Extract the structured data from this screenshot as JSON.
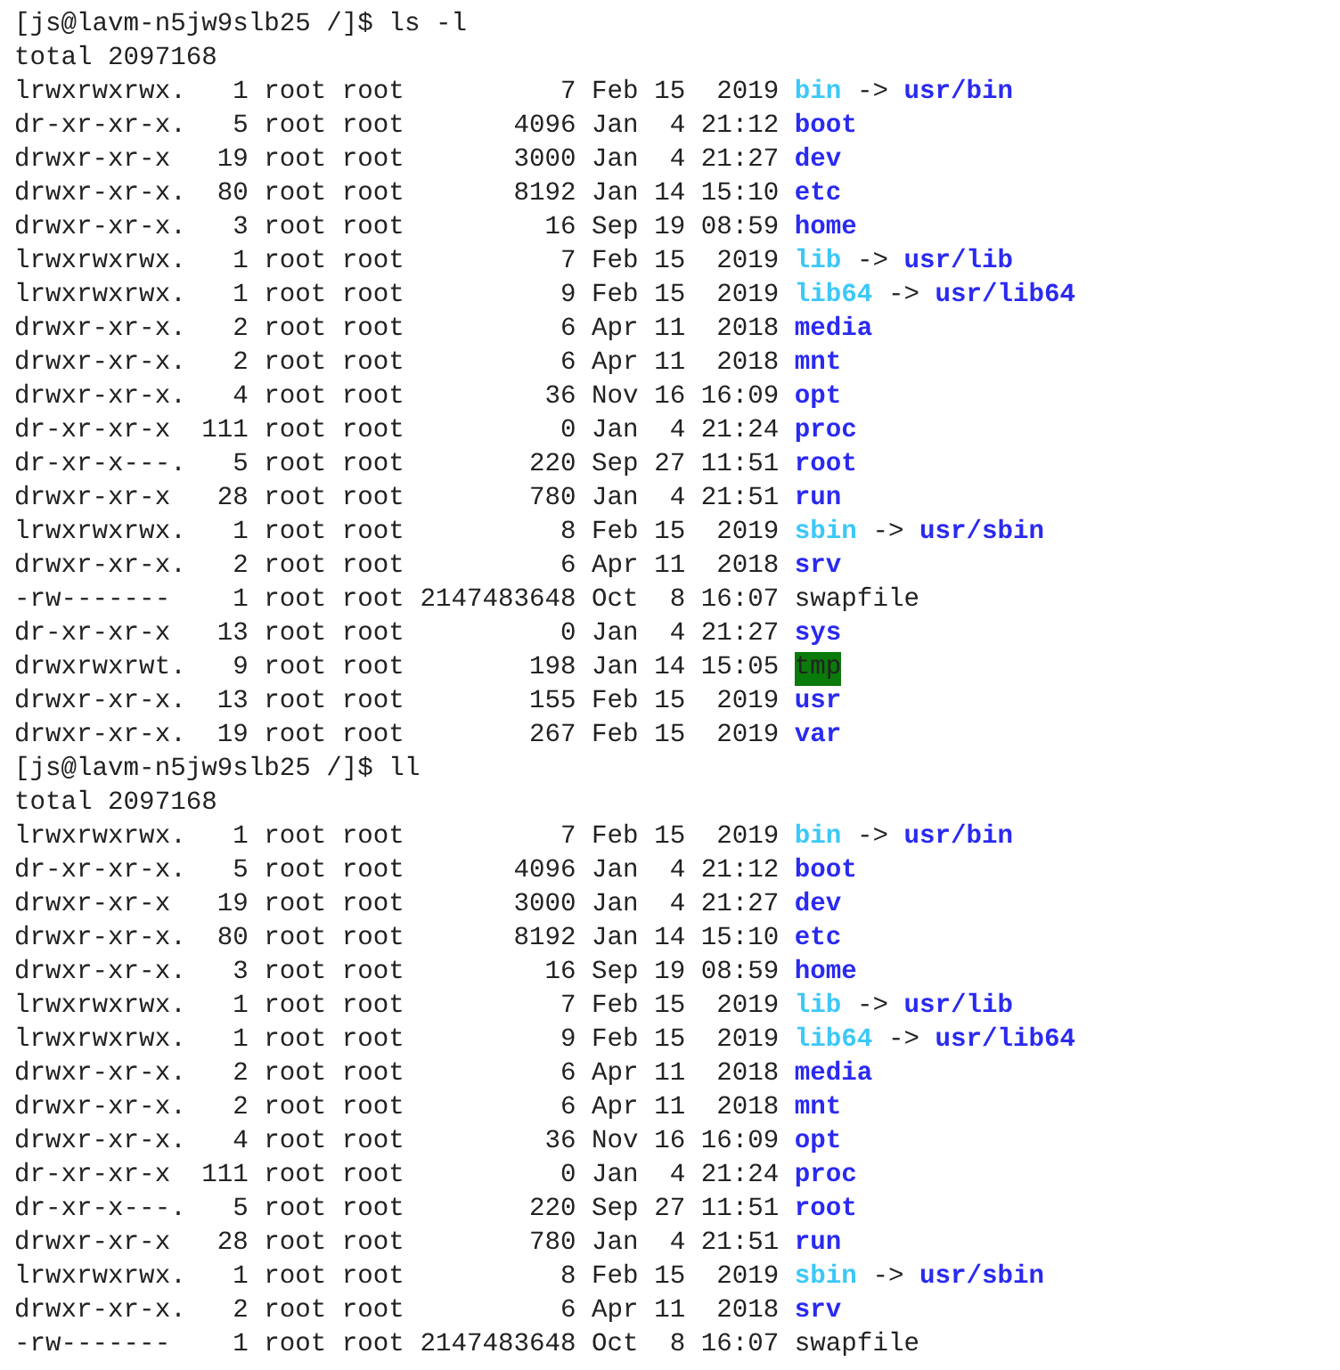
{
  "blocks": [
    {
      "prompt": "[js@lavm-n5jw9slb25 /]$ ls -l",
      "total": "total 2097168",
      "entries": [
        {
          "perms": "lrwxrwxrwx.",
          "links": "1",
          "owner": "root",
          "group": "root",
          "size": "7",
          "date": "Feb 15  2019",
          "name": "bin",
          "kind": "link",
          "arrow": "->",
          "target": "usr/bin"
        },
        {
          "perms": "dr-xr-xr-x.",
          "links": "5",
          "owner": "root",
          "group": "root",
          "size": "4096",
          "date": "Jan  4 21:12",
          "name": "boot",
          "kind": "dir"
        },
        {
          "perms": "drwxr-xr-x",
          "links": "19",
          "owner": "root",
          "group": "root",
          "size": "3000",
          "date": "Jan  4 21:27",
          "name": "dev",
          "kind": "dir"
        },
        {
          "perms": "drwxr-xr-x.",
          "links": "80",
          "owner": "root",
          "group": "root",
          "size": "8192",
          "date": "Jan 14 15:10",
          "name": "etc",
          "kind": "dir"
        },
        {
          "perms": "drwxr-xr-x.",
          "links": "3",
          "owner": "root",
          "group": "root",
          "size": "16",
          "date": "Sep 19 08:59",
          "name": "home",
          "kind": "dir"
        },
        {
          "perms": "lrwxrwxrwx.",
          "links": "1",
          "owner": "root",
          "group": "root",
          "size": "7",
          "date": "Feb 15  2019",
          "name": "lib",
          "kind": "link",
          "arrow": "->",
          "target": "usr/lib"
        },
        {
          "perms": "lrwxrwxrwx.",
          "links": "1",
          "owner": "root",
          "group": "root",
          "size": "9",
          "date": "Feb 15  2019",
          "name": "lib64",
          "kind": "link",
          "arrow": "->",
          "target": "usr/lib64"
        },
        {
          "perms": "drwxr-xr-x.",
          "links": "2",
          "owner": "root",
          "group": "root",
          "size": "6",
          "date": "Apr 11  2018",
          "name": "media",
          "kind": "dir"
        },
        {
          "perms": "drwxr-xr-x.",
          "links": "2",
          "owner": "root",
          "group": "root",
          "size": "6",
          "date": "Apr 11  2018",
          "name": "mnt",
          "kind": "dir"
        },
        {
          "perms": "drwxr-xr-x.",
          "links": "4",
          "owner": "root",
          "group": "root",
          "size": "36",
          "date": "Nov 16 16:09",
          "name": "opt",
          "kind": "dir"
        },
        {
          "perms": "dr-xr-xr-x",
          "links": "111",
          "owner": "root",
          "group": "root",
          "size": "0",
          "date": "Jan  4 21:24",
          "name": "proc",
          "kind": "dir"
        },
        {
          "perms": "dr-xr-x---.",
          "links": "5",
          "owner": "root",
          "group": "root",
          "size": "220",
          "date": "Sep 27 11:51",
          "name": "root",
          "kind": "dir"
        },
        {
          "perms": "drwxr-xr-x",
          "links": "28",
          "owner": "root",
          "group": "root",
          "size": "780",
          "date": "Jan  4 21:51",
          "name": "run",
          "kind": "dir"
        },
        {
          "perms": "lrwxrwxrwx.",
          "links": "1",
          "owner": "root",
          "group": "root",
          "size": "8",
          "date": "Feb 15  2019",
          "name": "sbin",
          "kind": "link",
          "arrow": "->",
          "target": "usr/sbin"
        },
        {
          "perms": "drwxr-xr-x.",
          "links": "2",
          "owner": "root",
          "group": "root",
          "size": "6",
          "date": "Apr 11  2018",
          "name": "srv",
          "kind": "dir"
        },
        {
          "perms": "-rw-------",
          "links": "1",
          "owner": "root",
          "group": "root",
          "size": "2147483648",
          "date": "Oct  8 16:07",
          "name": "swapfile",
          "kind": "file"
        },
        {
          "perms": "dr-xr-xr-x",
          "links": "13",
          "owner": "root",
          "group": "root",
          "size": "0",
          "date": "Jan  4 21:27",
          "name": "sys",
          "kind": "dir"
        },
        {
          "perms": "drwxrwxrwt.",
          "links": "9",
          "owner": "root",
          "group": "root",
          "size": "198",
          "date": "Jan 14 15:05",
          "name": "tmp",
          "kind": "sticky"
        },
        {
          "perms": "drwxr-xr-x.",
          "links": "13",
          "owner": "root",
          "group": "root",
          "size": "155",
          "date": "Feb 15  2019",
          "name": "usr",
          "kind": "dir"
        },
        {
          "perms": "drwxr-xr-x.",
          "links": "19",
          "owner": "root",
          "group": "root",
          "size": "267",
          "date": "Feb 15  2019",
          "name": "var",
          "kind": "dir"
        }
      ]
    },
    {
      "prompt": "[js@lavm-n5jw9slb25 /]$ ll",
      "total": "total 2097168",
      "entries": [
        {
          "perms": "lrwxrwxrwx.",
          "links": "1",
          "owner": "root",
          "group": "root",
          "size": "7",
          "date": "Feb 15  2019",
          "name": "bin",
          "kind": "link",
          "arrow": "->",
          "target": "usr/bin"
        },
        {
          "perms": "dr-xr-xr-x.",
          "links": "5",
          "owner": "root",
          "group": "root",
          "size": "4096",
          "date": "Jan  4 21:12",
          "name": "boot",
          "kind": "dir"
        },
        {
          "perms": "drwxr-xr-x",
          "links": "19",
          "owner": "root",
          "group": "root",
          "size": "3000",
          "date": "Jan  4 21:27",
          "name": "dev",
          "kind": "dir"
        },
        {
          "perms": "drwxr-xr-x.",
          "links": "80",
          "owner": "root",
          "group": "root",
          "size": "8192",
          "date": "Jan 14 15:10",
          "name": "etc",
          "kind": "dir"
        },
        {
          "perms": "drwxr-xr-x.",
          "links": "3",
          "owner": "root",
          "group": "root",
          "size": "16",
          "date": "Sep 19 08:59",
          "name": "home",
          "kind": "dir"
        },
        {
          "perms": "lrwxrwxrwx.",
          "links": "1",
          "owner": "root",
          "group": "root",
          "size": "7",
          "date": "Feb 15  2019",
          "name": "lib",
          "kind": "link",
          "arrow": "->",
          "target": "usr/lib"
        },
        {
          "perms": "lrwxrwxrwx.",
          "links": "1",
          "owner": "root",
          "group": "root",
          "size": "9",
          "date": "Feb 15  2019",
          "name": "lib64",
          "kind": "link",
          "arrow": "->",
          "target": "usr/lib64"
        },
        {
          "perms": "drwxr-xr-x.",
          "links": "2",
          "owner": "root",
          "group": "root",
          "size": "6",
          "date": "Apr 11  2018",
          "name": "media",
          "kind": "dir"
        },
        {
          "perms": "drwxr-xr-x.",
          "links": "2",
          "owner": "root",
          "group": "root",
          "size": "6",
          "date": "Apr 11  2018",
          "name": "mnt",
          "kind": "dir"
        },
        {
          "perms": "drwxr-xr-x.",
          "links": "4",
          "owner": "root",
          "group": "root",
          "size": "36",
          "date": "Nov 16 16:09",
          "name": "opt",
          "kind": "dir"
        },
        {
          "perms": "dr-xr-xr-x",
          "links": "111",
          "owner": "root",
          "group": "root",
          "size": "0",
          "date": "Jan  4 21:24",
          "name": "proc",
          "kind": "dir"
        },
        {
          "perms": "dr-xr-x---.",
          "links": "5",
          "owner": "root",
          "group": "root",
          "size": "220",
          "date": "Sep 27 11:51",
          "name": "root",
          "kind": "dir"
        },
        {
          "perms": "drwxr-xr-x",
          "links": "28",
          "owner": "root",
          "group": "root",
          "size": "780",
          "date": "Jan  4 21:51",
          "name": "run",
          "kind": "dir"
        },
        {
          "perms": "lrwxrwxrwx.",
          "links": "1",
          "owner": "root",
          "group": "root",
          "size": "8",
          "date": "Feb 15  2019",
          "name": "sbin",
          "kind": "link",
          "arrow": "->",
          "target": "usr/sbin"
        },
        {
          "perms": "drwxr-xr-x.",
          "links": "2",
          "owner": "root",
          "group": "root",
          "size": "6",
          "date": "Apr 11  2018",
          "name": "srv",
          "kind": "dir"
        },
        {
          "perms": "-rw-------",
          "links": "1",
          "owner": "root",
          "group": "root",
          "size": "2147483648",
          "date": "Oct  8 16:07",
          "name": "swapfile",
          "kind": "file"
        }
      ]
    }
  ]
}
